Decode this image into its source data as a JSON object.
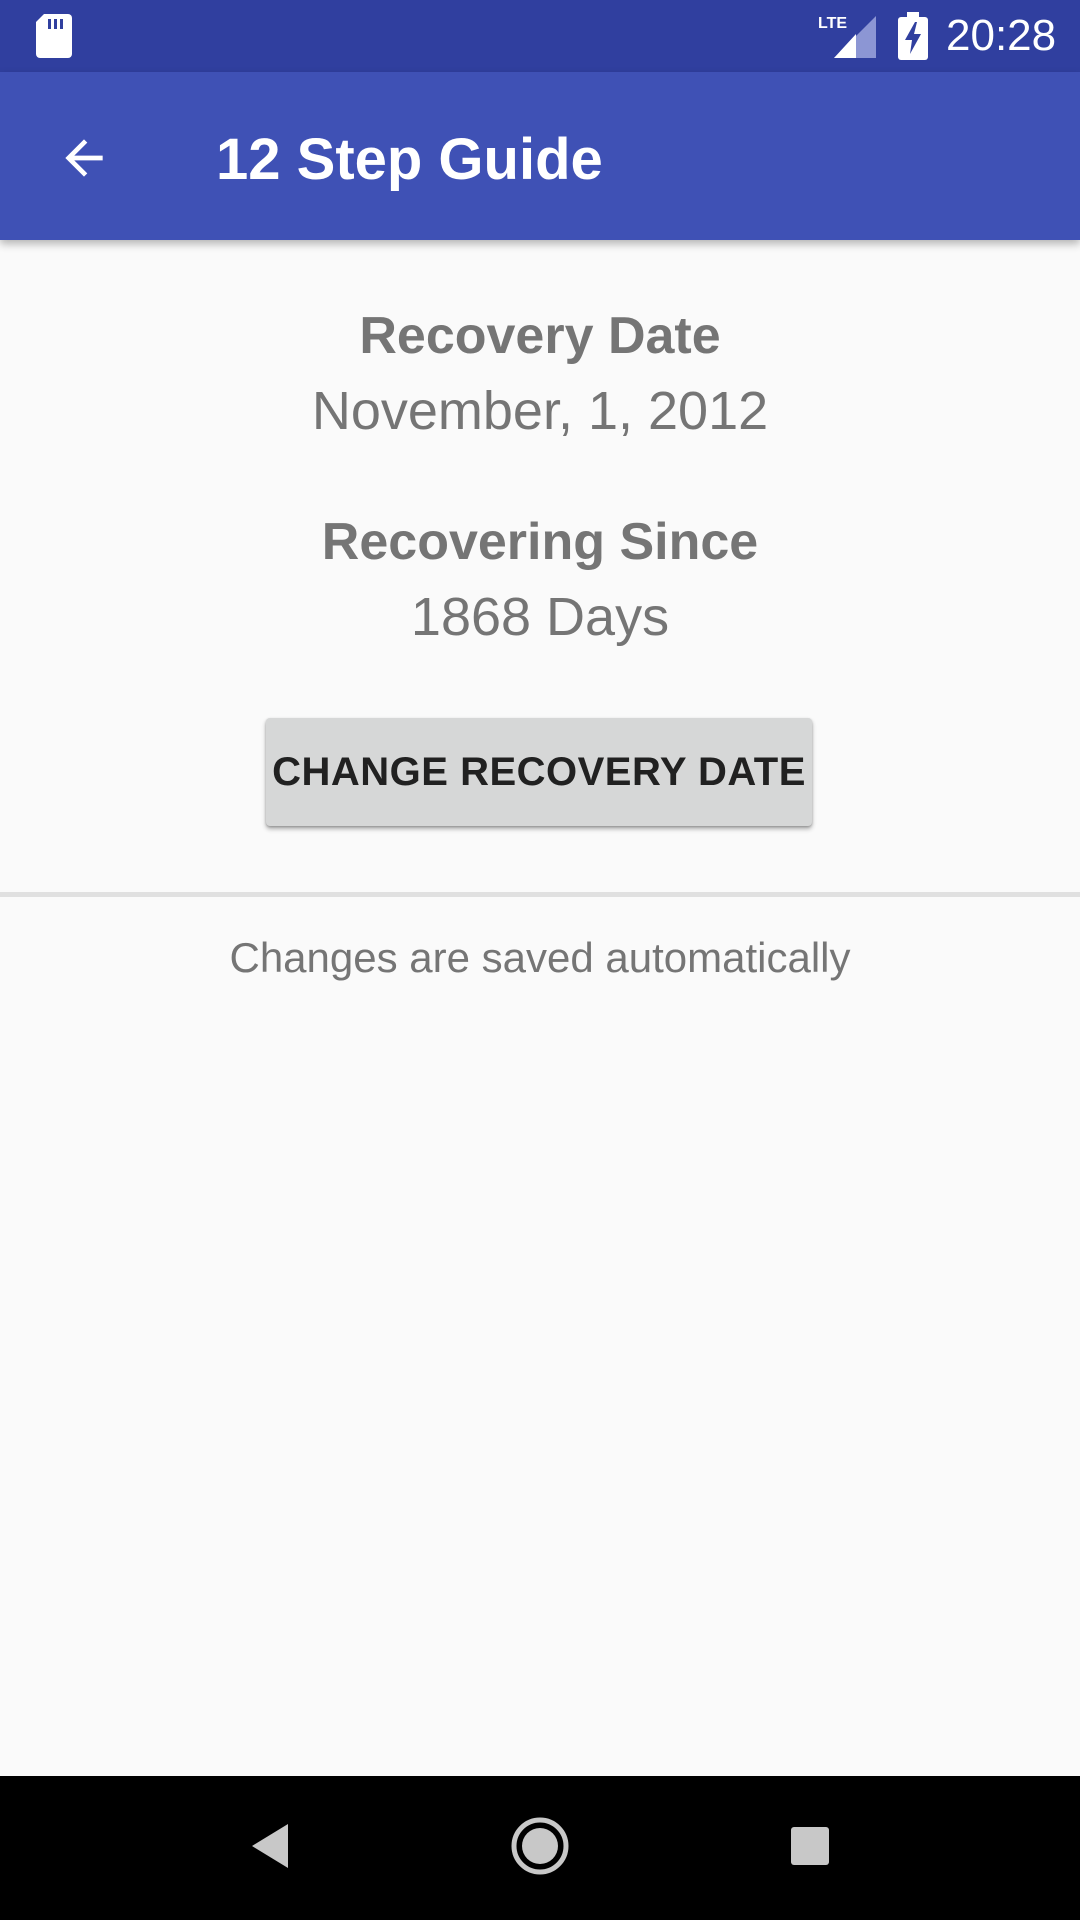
{
  "status_bar": {
    "time": "20:28",
    "network_label": "LTE",
    "icons": [
      "sd-card-icon",
      "lte-signal-icon",
      "battery-charging-icon"
    ],
    "background_color": "#303f9f"
  },
  "app_bar": {
    "title": "12 Step Guide",
    "back_icon": "arrow-back-icon",
    "background_color": "#3f51b5"
  },
  "main": {
    "recovery_date_label": "Recovery Date",
    "recovery_date_value": "November, 1, 2012",
    "recovering_since_label": "Recovering Since",
    "recovering_since_value": "1868 Days",
    "change_button_label": "CHANGE RECOVERY DATE",
    "footnote": "Changes are saved automatically"
  },
  "nav_bar": {
    "icons": [
      "nav-back-icon",
      "nav-home-icon",
      "nav-recents-icon"
    ]
  },
  "colors": {
    "text_secondary": "#757575",
    "button_background": "#d6d7d7",
    "page_background": "#fafafa"
  }
}
